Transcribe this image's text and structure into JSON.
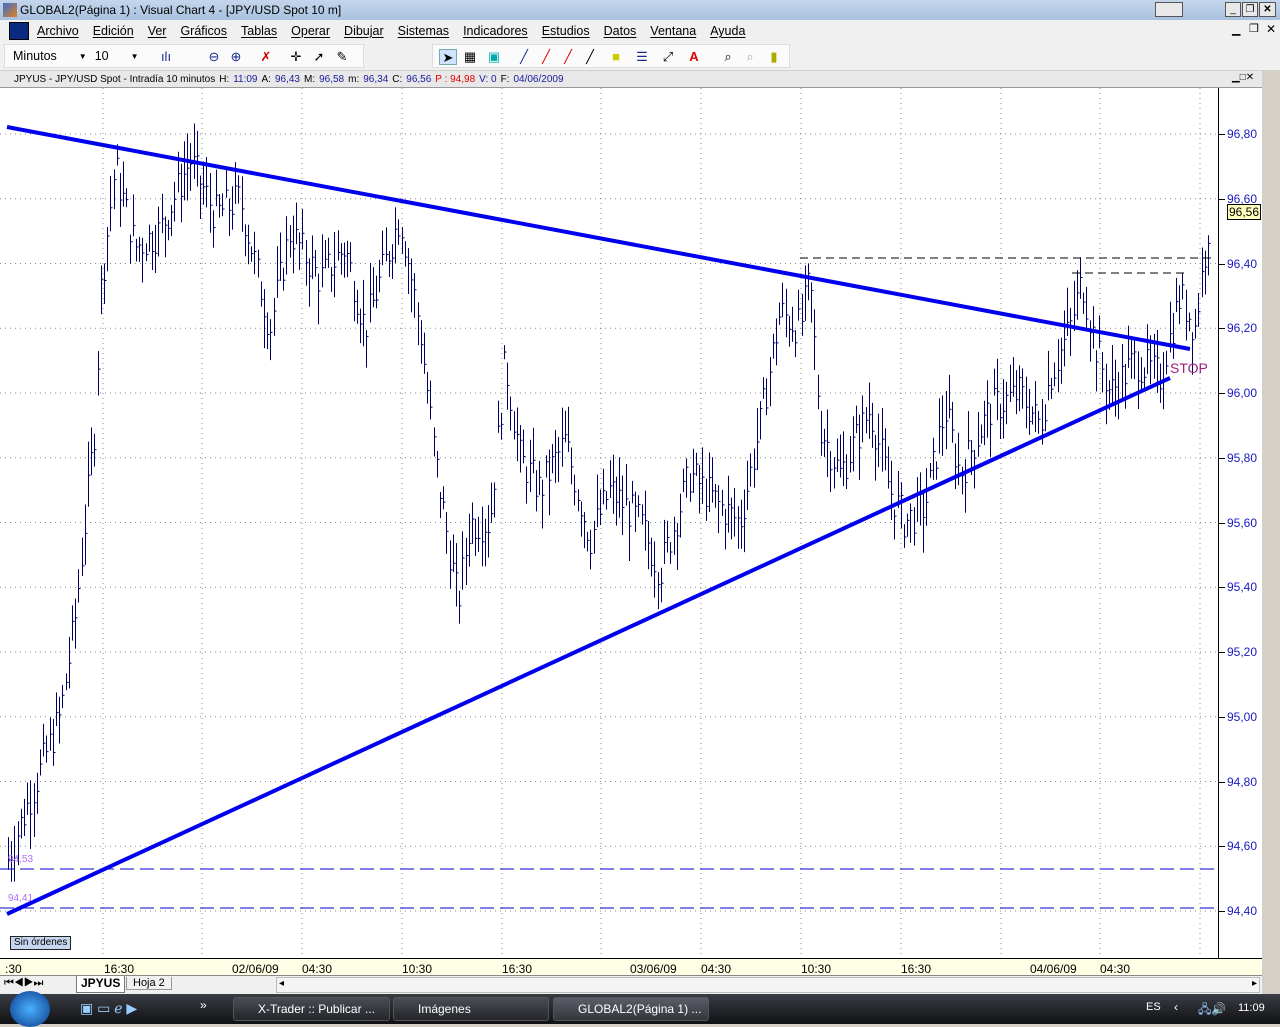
{
  "window": {
    "title": "GLOBAL2(Página 1) : Visual Chart 4 - [JPY/USD Spot 10 m]"
  },
  "menu": [
    "Archivo",
    "Edición",
    "Ver",
    "Gráficos",
    "Tablas",
    "Operar",
    "Dibujar",
    "Sistemas",
    "Indicadores",
    "Estudios",
    "Datos",
    "Ventana",
    "Ayuda"
  ],
  "toolbar": {
    "period_unit": "Minutos",
    "period_value": "10"
  },
  "info": {
    "symbol": "JPYUS - JPY/USD Spot - Intradía 10 minutos",
    "h_label": "H:",
    "h": "11:09",
    "a_label": "A:",
    "a": "96,43",
    "m_label": "M:",
    "m": "96,58",
    "mn_label": "m:",
    "mn": "96,34",
    "c_label": "C:",
    "c": "96,56",
    "p": "P : 94,98",
    "v": "V: 0",
    "f_label": "F:",
    "f": "04/06/2009"
  },
  "price_axis": [
    "96,80",
    "96,60",
    "96,40",
    "96,20",
    "96,00",
    "95,80",
    "95,60",
    "95,40",
    "95,20",
    "95,00",
    "94,80",
    "94,60",
    "94,40"
  ],
  "last_price": "96,56",
  "level_labels": [
    "94,53",
    "94,41"
  ],
  "stop_label": "STOP",
  "orders_label": "Sin órdenes",
  "time_axis": [
    ":30",
    "16:30",
    "02/06/09",
    "04:30",
    "10:30",
    "16:30",
    "03/06/09",
    "04:30",
    "10:30",
    "16:30",
    "04/06/09",
    "04:30"
  ],
  "sheet_tabs": [
    "JPYUS",
    "Hoja 2"
  ],
  "colors": {
    "trendline": "#0000ee",
    "bars": "#000060",
    "stop": "#a02080"
  },
  "taskbar": {
    "tasks": [
      "X-Trader :: Publicar ...",
      "Imágenes",
      "GLOBAL2(Página 1) ..."
    ],
    "lang": "ES",
    "clock": "11:09"
  }
}
